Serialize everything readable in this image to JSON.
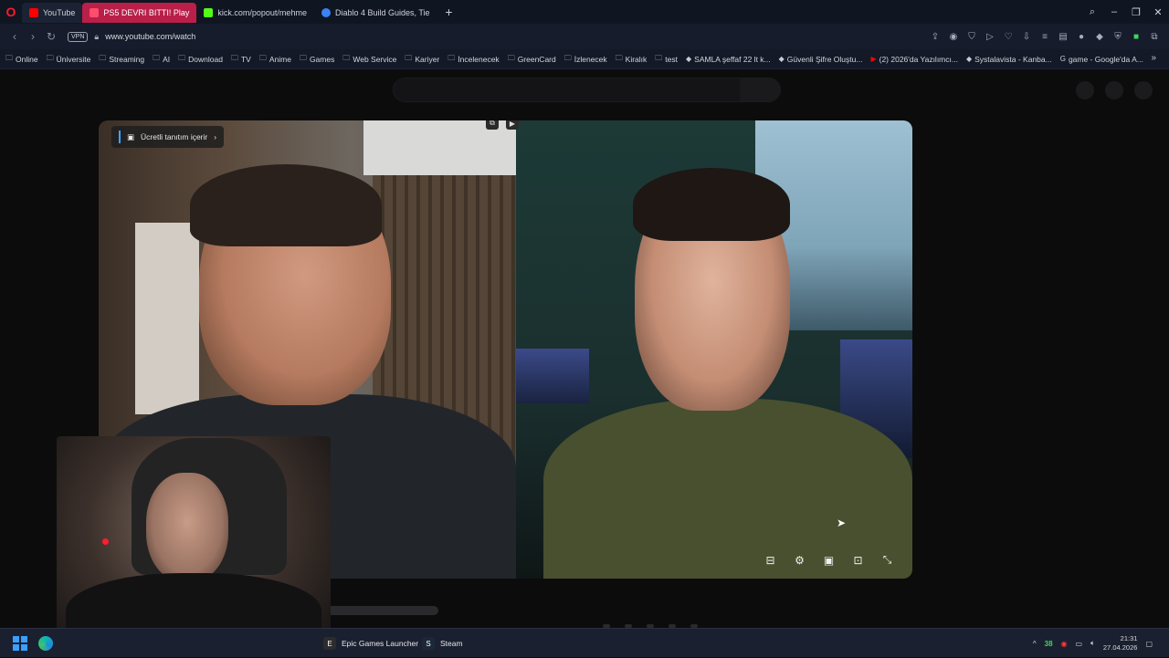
{
  "browser": {
    "logo": "O",
    "tabs": [
      {
        "label": "YouTube",
        "state": "active",
        "color": "#ff0000"
      },
      {
        "label": "PS5 DEVRI BITTI! Play",
        "state": "playing",
        "color": "#ff0033"
      },
      {
        "label": "kick.com/popout/mehme",
        "state": "normal",
        "color": "#53fc18"
      },
      {
        "label": "Diablo 4 Build Guides, Tie",
        "state": "normal",
        "color": "#3b82f6"
      }
    ],
    "new_tab": "+",
    "window_controls": [
      "⌕",
      "–",
      "❐",
      "✕"
    ],
    "vpn_badge": "VPN",
    "url": "www.youtube.com/watch",
    "bookmarks": [
      {
        "label": "Online",
        "icon": "folder-icon"
      },
      {
        "label": "Üniversite",
        "icon": "folder-icon"
      },
      {
        "label": "Streaming",
        "icon": "folder-icon"
      },
      {
        "label": "AI",
        "icon": "folder-icon"
      },
      {
        "label": "Download",
        "icon": "folder-icon"
      },
      {
        "label": "TV",
        "icon": "folder-icon"
      },
      {
        "label": "Anime",
        "icon": "folder-icon"
      },
      {
        "label": "Games",
        "icon": "folder-icon"
      },
      {
        "label": "Web Service",
        "icon": "folder-icon"
      },
      {
        "label": "Kariyer",
        "icon": "folder-icon"
      },
      {
        "label": "İncelenecek",
        "icon": "folder-icon"
      },
      {
        "label": "GreenCard",
        "icon": "folder-icon"
      },
      {
        "label": "İzlenecek",
        "icon": "folder-icon"
      },
      {
        "label": "Kiralık",
        "icon": "folder-icon"
      },
      {
        "label": "test",
        "icon": "folder-icon"
      },
      {
        "label": "SAMLA şeffaf 22 lt k...",
        "icon": "site-icon"
      },
      {
        "label": "Güvenli Şifre Oluştu...",
        "icon": "site-icon"
      },
      {
        "label": "(2) 2026'da Yazılımcı...",
        "icon": "youtube-icon"
      },
      {
        "label": "Systalavista - Kanba...",
        "icon": "site-icon"
      },
      {
        "label": "game - Google'da A...",
        "icon": "google-icon"
      }
    ],
    "bookmarks_more": "»"
  },
  "player": {
    "promo_label": "Ücretli tanıtım içerir",
    "promo_chevron": "›",
    "controls": [
      "subtitles-icon",
      "settings-icon",
      "miniplayer-icon",
      "cast-icon",
      "fullscreen-icon"
    ]
  },
  "taskbar": {
    "apps": [
      {
        "label": "Epic Games Launcher",
        "icon": "epic-icon"
      },
      {
        "label": "Steam",
        "icon": "steam-icon"
      }
    ],
    "tray_chevron": "^",
    "tray_number": "38",
    "time": "21:31",
    "date": "27.04.2026"
  },
  "colors": {
    "accent": "#3ea6ff",
    "playing_tab": "#b91f48",
    "record": "#ff1e2d"
  }
}
